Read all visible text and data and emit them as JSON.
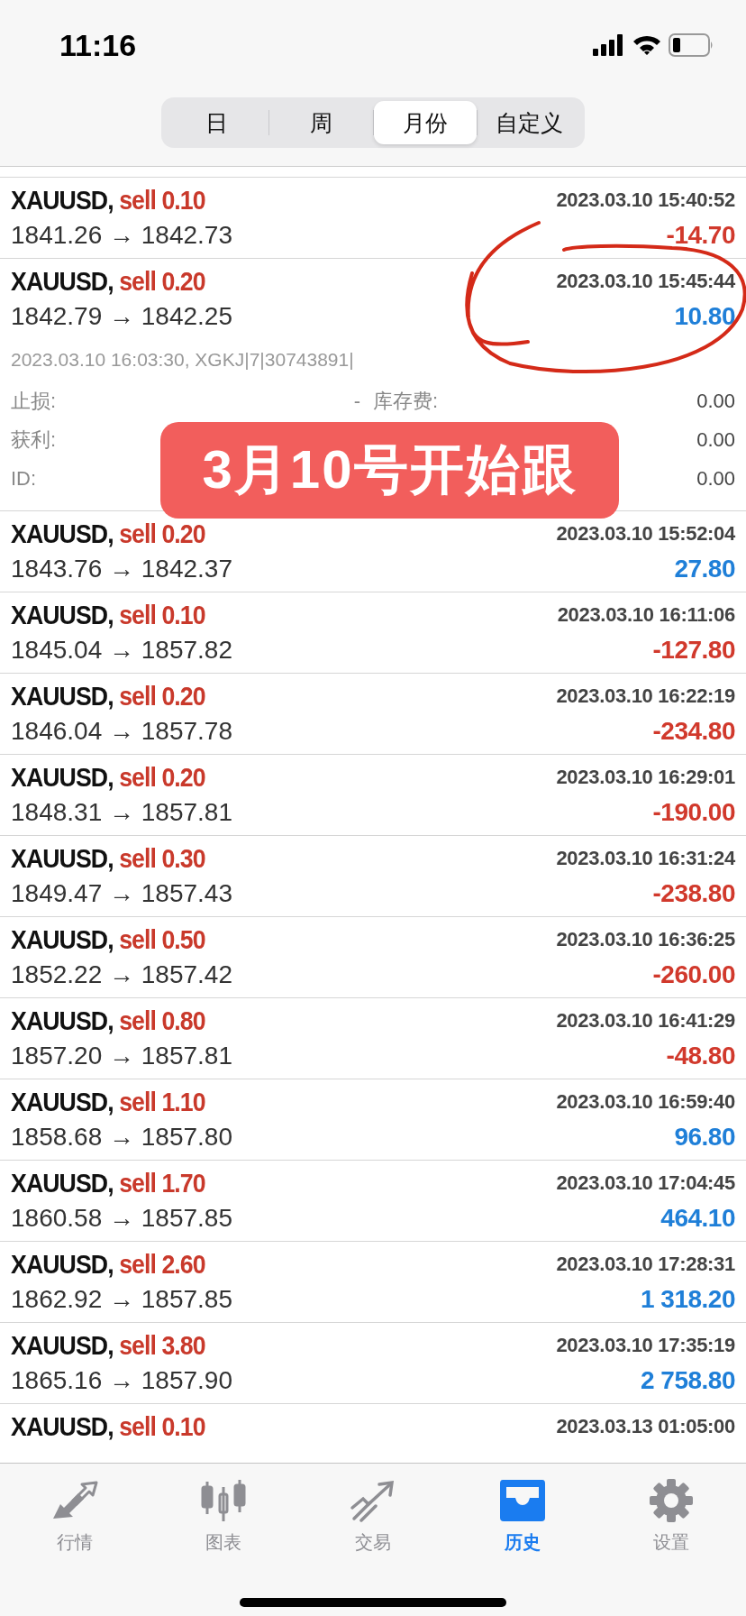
{
  "status_bar": {
    "time": "11:16"
  },
  "periods": [
    {
      "label": "日",
      "selected": false
    },
    {
      "label": "周",
      "selected": false
    },
    {
      "label": "月份",
      "selected": true
    },
    {
      "label": "自定义",
      "selected": false
    }
  ],
  "trades": [
    {
      "symbol": "XAUUSD,",
      "order": "sell 0.10",
      "time": "2023.03.10 15:40:52",
      "prices": "1841.26 → 1842.73",
      "profit": "-14.70",
      "color": "#d1392c"
    },
    {
      "symbol": "XAUUSD,",
      "order": "sell 0.20",
      "time": "2023.03.10 15:45:44",
      "prices": "1842.79 → 1842.25",
      "profit": "10.80",
      "color": "#1f7fd8",
      "details": {
        "comment": "2023.03.10 16:03:30, XGKJ|7|30743891|",
        "fields": [
          {
            "left_label": "止损:",
            "left_value": "-",
            "right_label": "库存费:",
            "right_value": "0.00"
          },
          {
            "left_label": "获利:",
            "right_value": "0.00"
          },
          {
            "left_label": "ID:",
            "right_value": "0.00"
          }
        ]
      }
    },
    {
      "symbol": "XAUUSD,",
      "order": "sell 0.20",
      "time": "2023.03.10 15:52:04",
      "prices": "1843.76 → 1842.37",
      "profit": "27.80",
      "color": "#1f7fd8"
    },
    {
      "symbol": "XAUUSD,",
      "order": "sell 0.10",
      "time": "2023.03.10 16:11:06",
      "prices": "1845.04 → 1857.82",
      "profit": "-127.80",
      "color": "#d1392c"
    },
    {
      "symbol": "XAUUSD,",
      "order": "sell 0.20",
      "time": "2023.03.10 16:22:19",
      "prices": "1846.04 → 1857.78",
      "profit": "-234.80",
      "color": "#d1392c"
    },
    {
      "symbol": "XAUUSD,",
      "order": "sell 0.20",
      "time": "2023.03.10 16:29:01",
      "prices": "1848.31 → 1857.81",
      "profit": "-190.00",
      "color": "#d1392c"
    },
    {
      "symbol": "XAUUSD,",
      "order": "sell 0.30",
      "time": "2023.03.10 16:31:24",
      "prices": "1849.47 → 1857.43",
      "profit": "-238.80",
      "color": "#d1392c"
    },
    {
      "symbol": "XAUUSD,",
      "order": "sell 0.50",
      "time": "2023.03.10 16:36:25",
      "prices": "1852.22 → 1857.42",
      "profit": "-260.00",
      "color": "#d1392c"
    },
    {
      "symbol": "XAUUSD,",
      "order": "sell 0.80",
      "time": "2023.03.10 16:41:29",
      "prices": "1857.20 → 1857.81",
      "profit": "-48.80",
      "color": "#d1392c"
    },
    {
      "symbol": "XAUUSD,",
      "order": "sell 1.10",
      "time": "2023.03.10 16:59:40",
      "prices": "1858.68 → 1857.80",
      "profit": "96.80",
      "color": "#1f7fd8"
    },
    {
      "symbol": "XAUUSD,",
      "order": "sell 1.70",
      "time": "2023.03.10 17:04:45",
      "prices": "1860.58 → 1857.85",
      "profit": "464.10",
      "color": "#1f7fd8"
    },
    {
      "symbol": "XAUUSD,",
      "order": "sell 2.60",
      "time": "2023.03.10 17:28:31",
      "prices": "1862.92 → 1857.85",
      "profit": "1 318.20",
      "color": "#1f7fd8"
    },
    {
      "symbol": "XAUUSD,",
      "order": "sell 3.80",
      "time": "2023.03.10 17:35:19",
      "prices": "1865.16 → 1857.90",
      "profit": "2 758.80",
      "color": "#1f7fd8"
    },
    {
      "symbol": "XAUUSD,",
      "order": "sell 0.10",
      "time": "2023.03.13 01:05:00"
    }
  ],
  "caption": "3月10号开始跟",
  "tab_bar": [
    {
      "label": "行情",
      "selected": false
    },
    {
      "label": "图表",
      "selected": false
    },
    {
      "label": "交易",
      "selected": false
    },
    {
      "label": "历史",
      "selected": true
    },
    {
      "label": "设置",
      "selected": false
    }
  ]
}
